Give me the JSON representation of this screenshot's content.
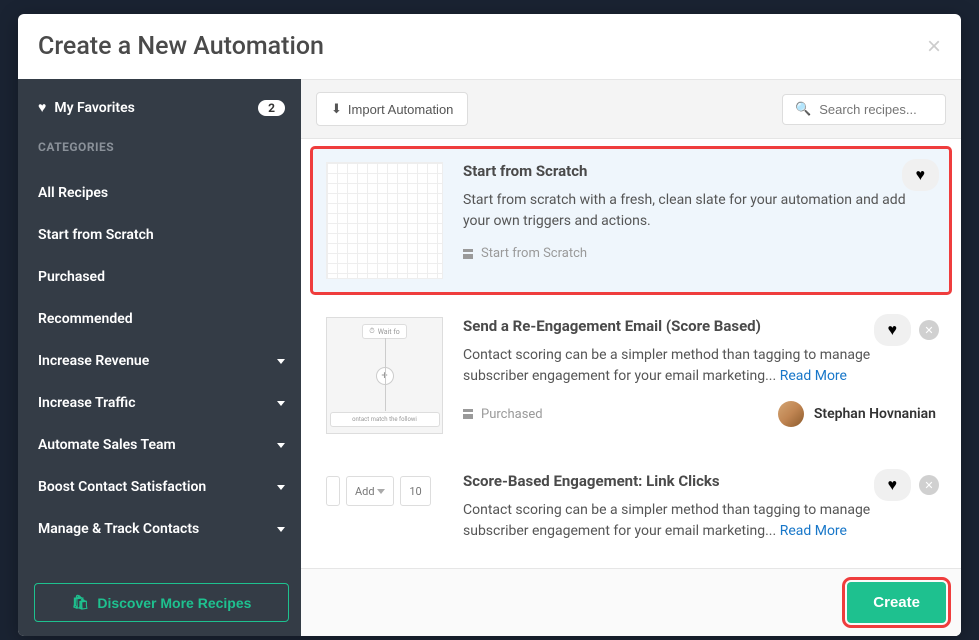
{
  "modal": {
    "title": "Create a New Automation"
  },
  "sidebar": {
    "favorites_label": "My Favorites",
    "favorites_count": "2",
    "categories_label": "CATEGORIES",
    "items": [
      {
        "label": "All Recipes",
        "expandable": false
      },
      {
        "label": "Start from Scratch",
        "expandable": false
      },
      {
        "label": "Purchased",
        "expandable": false
      },
      {
        "label": "Recommended",
        "expandable": false
      },
      {
        "label": "Increase Revenue",
        "expandable": true
      },
      {
        "label": "Increase Traffic",
        "expandable": true
      },
      {
        "label": "Automate Sales Team",
        "expandable": true
      },
      {
        "label": "Boost Contact Satisfaction",
        "expandable": true
      },
      {
        "label": "Manage & Track Contacts",
        "expandable": true
      }
    ],
    "discover_label": "Discover More Recipes"
  },
  "toolbar": {
    "import_label": "Import Automation",
    "search_placeholder": "Search recipes..."
  },
  "cards": [
    {
      "title": "Start from Scratch",
      "description": "Start from scratch with a fresh, clean slate for your automation and add your own triggers and actions.",
      "tag": "Start from Scratch",
      "selected": true,
      "has_remove": false,
      "author": null
    },
    {
      "title": "Send a Re-Engagement Email (Score Based)",
      "description": "Contact scoring can be a simpler method than tagging to manage subscriber engagement for your email marketing...",
      "read_more": "Read More",
      "tag": "Purchased",
      "selected": false,
      "has_remove": true,
      "author": "Stephan Hovnanian"
    },
    {
      "title": "Score-Based Engagement: Link Clicks",
      "description": "Contact scoring can be a simpler method than tagging to manage subscriber engagement for your email marketing...",
      "read_more": "Read More",
      "tag": "",
      "selected": false,
      "has_remove": true,
      "author": null
    }
  ],
  "preview_thumb": {
    "wait_label": "Wait fo",
    "match_label": "ontact match the followi"
  },
  "controls_thumb": {
    "add_label": "Add",
    "value": "10"
  },
  "footer": {
    "create_label": "Create"
  }
}
